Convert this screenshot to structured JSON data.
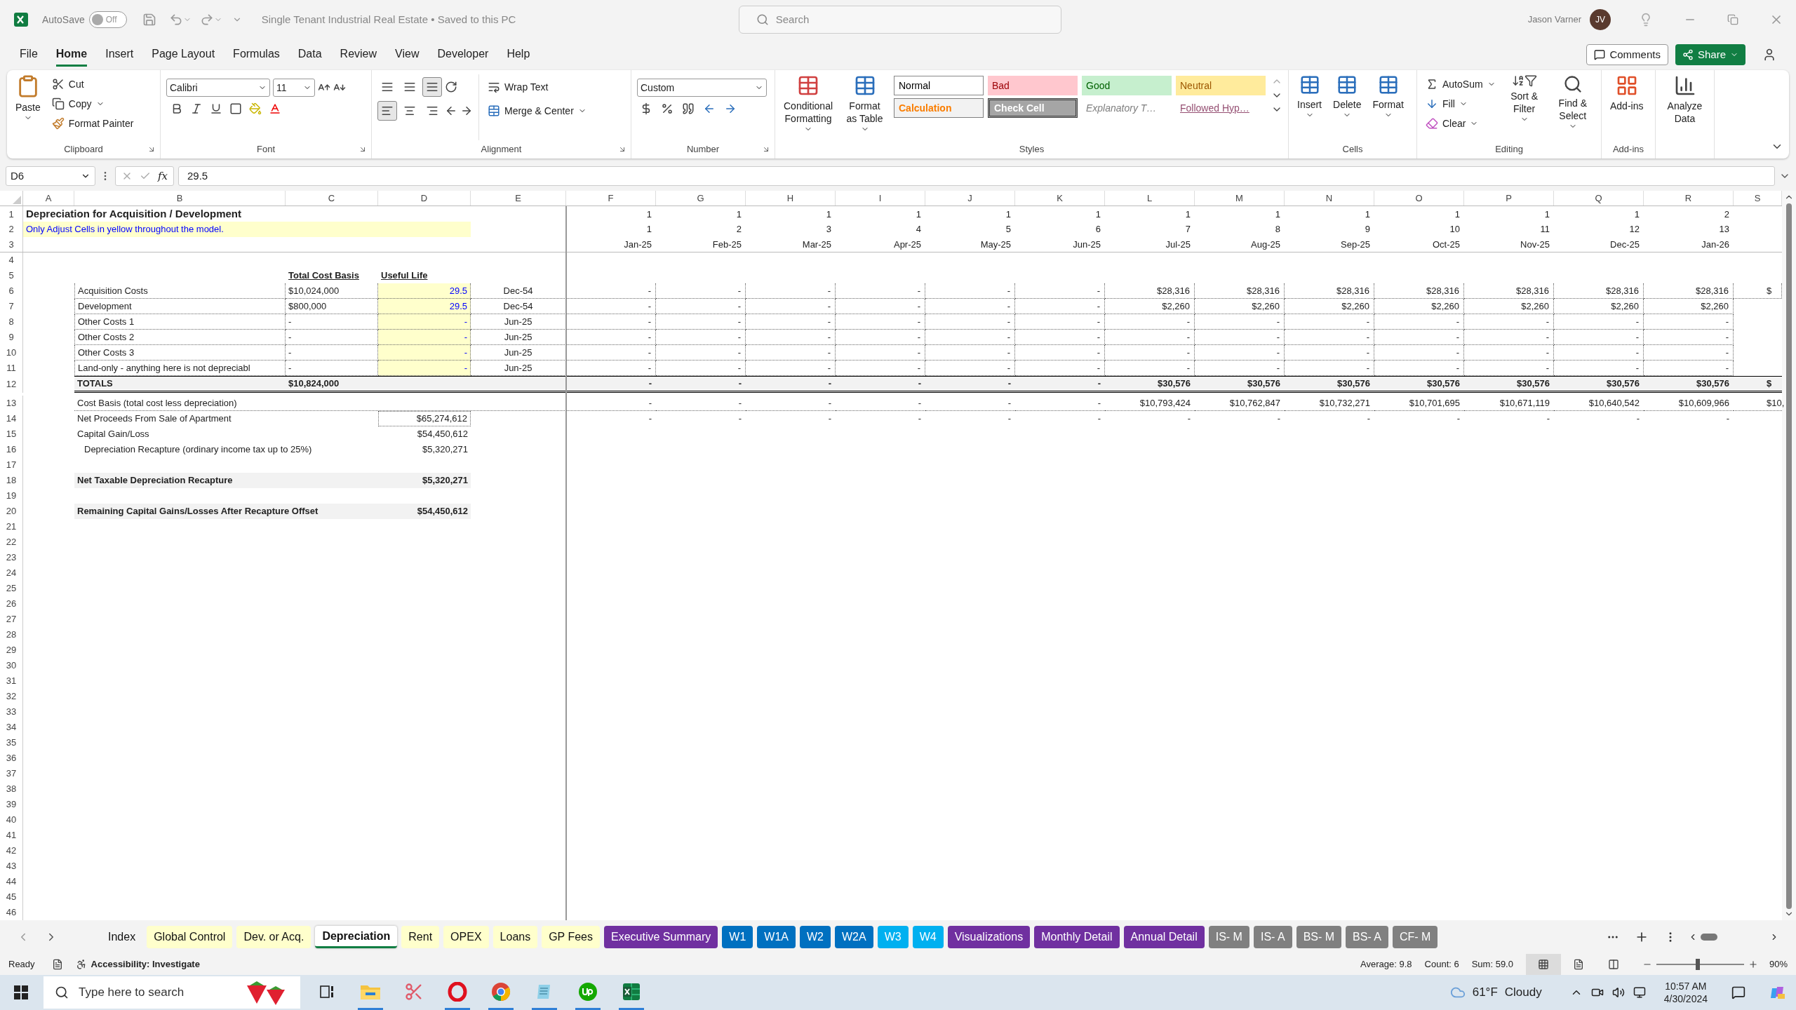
{
  "title_bar": {
    "autosave_label": "AutoSave",
    "autosave_state": "Off",
    "autosave_on": false,
    "doc_title": "Single Tenant Industrial Real Estate • Saved to this PC",
    "search_placeholder": "Search",
    "user_name": "Jason Varner",
    "user_initials": "JV"
  },
  "menu_tabs": [
    {
      "label": "File",
      "selected": false
    },
    {
      "label": "Home",
      "selected": true
    },
    {
      "label": "Insert",
      "selected": false
    },
    {
      "label": "Page Layout",
      "selected": false
    },
    {
      "label": "Formulas",
      "selected": false
    },
    {
      "label": "Data",
      "selected": false
    },
    {
      "label": "Review",
      "selected": false
    },
    {
      "label": "View",
      "selected": false
    },
    {
      "label": "Developer",
      "selected": false
    },
    {
      "label": "Help",
      "selected": false
    }
  ],
  "comments_button": "Comments",
  "share_button": "Share",
  "ribbon": {
    "clipboard": {
      "paste": "Paste",
      "cut": "Cut",
      "copy": "Copy",
      "format_painter": "Format Painter",
      "label": "Clipboard"
    },
    "font": {
      "name": "Calibri",
      "size": "11",
      "label": "Font"
    },
    "alignment": {
      "vertical_align": [
        {
          "selected": false
        },
        {
          "selected": false
        },
        {
          "selected": true
        }
      ],
      "horizontal_align": [
        {
          "selected": true
        },
        {
          "selected": false
        },
        {
          "selected": false
        }
      ],
      "wrap_text": "Wrap Text",
      "merge": "Merge & Center",
      "label": "Alignment"
    },
    "number": {
      "format": "Custom",
      "label": "Number"
    },
    "styles": {
      "conditional": "Conditional Formatting",
      "format_table": "Format as Table",
      "cells": [
        {
          "text": "Normal",
          "kind": "normal"
        },
        {
          "text": "Bad",
          "kind": "bad"
        },
        {
          "text": "Good",
          "kind": "good"
        },
        {
          "text": "Neutral",
          "kind": "neutral"
        },
        {
          "text": "Calculation",
          "kind": "calculation"
        },
        {
          "text": "Check Cell",
          "kind": "check"
        },
        {
          "text": "Explanatory T…",
          "kind": "explanatory"
        },
        {
          "text": "Followed Hyp…",
          "kind": "hyperlink"
        }
      ],
      "label": "Styles"
    },
    "cells": {
      "buttons": [
        "Insert",
        "Delete",
        "Format"
      ],
      "label": "Cells"
    },
    "editing": {
      "autosum": "AutoSum",
      "fill": "Fill",
      "clear": "Clear",
      "sort": "Sort & Filter",
      "find": "Find & Select",
      "label": "Editing"
    },
    "addins": {
      "button": "Add-ins",
      "label": "Add-ins"
    },
    "analyze": "Analyze Data"
  },
  "formula_bar": {
    "name_box": "D6",
    "function_label": "fx",
    "formula": "29.5"
  },
  "sheet": {
    "columns": [
      "A",
      "B",
      "C",
      "D",
      "E",
      "F",
      "G",
      "H",
      "I",
      "J",
      "K",
      "L",
      "M",
      "N",
      "O",
      "P",
      "Q",
      "R",
      "S"
    ],
    "rows": [
      {
        "n": "1",
        "kind": "title",
        "text": "Depreciation for Acquisition / Development",
        "months": [
          "1",
          "1",
          "1",
          "1",
          "1",
          "1",
          "1",
          "1",
          "1",
          "1",
          "1",
          "1",
          "2"
        ]
      },
      {
        "n": "2",
        "kind": "note",
        "text": "Only Adjust Cells in yellow throughout the model.",
        "months": [
          "1",
          "2",
          "3",
          "4",
          "5",
          "6",
          "7",
          "8",
          "9",
          "10",
          "11",
          "12",
          "13"
        ]
      },
      {
        "n": "3",
        "kind": "dates",
        "months": [
          "Jan-25",
          "Feb-25",
          "Mar-25",
          "Apr-25",
          "May-25",
          "Jun-25",
          "Jul-25",
          "Aug-25",
          "Sep-25",
          "Oct-25",
          "Nov-25",
          "Dec-25",
          "Jan-26"
        ]
      },
      {
        "n": "4",
        "kind": "blank"
      },
      {
        "n": "5",
        "kind": "headers",
        "cost_basis_heading": "Total Cost Basis",
        "useful_life_heading": "Useful Life"
      },
      {
        "n": "6",
        "kind": "item",
        "label": "Acquisition Costs",
        "cost_basis": "$10,024,000",
        "useful_life": "29.5",
        "end_date": "Dec-54",
        "months": [
          "-",
          "-",
          "-",
          "-",
          "-",
          "-",
          "$28,316",
          "$28,316",
          "$28,316",
          "$28,316",
          "$28,316",
          "$28,316",
          "$28,316"
        ],
        "cut_off": "$"
      },
      {
        "n": "7",
        "kind": "item",
        "label": "Development",
        "cost_basis": "$800,000",
        "useful_life": "29.5",
        "end_date": "Dec-54",
        "months": [
          "-",
          "-",
          "-",
          "-",
          "-",
          "-",
          "$2,260",
          "$2,260",
          "$2,260",
          "$2,260",
          "$2,260",
          "$2,260",
          "$2,260"
        ]
      },
      {
        "n": "8",
        "kind": "item",
        "label": "Other Costs 1",
        "cost_basis": "-",
        "useful_life": "-",
        "end_date": "Jun-25",
        "months": [
          "-",
          "-",
          "-",
          "-",
          "-",
          "-",
          "-",
          "-",
          "-",
          "-",
          "-",
          "-",
          "-"
        ]
      },
      {
        "n": "9",
        "kind": "item",
        "label": "Other Costs 2",
        "cost_basis": "-",
        "useful_life": "-",
        "end_date": "Jun-25",
        "months": [
          "-",
          "-",
          "-",
          "-",
          "-",
          "-",
          "-",
          "-",
          "-",
          "-",
          "-",
          "-",
          "-"
        ]
      },
      {
        "n": "10",
        "kind": "item",
        "label": "Other Costs 3",
        "cost_basis": "-",
        "useful_life": "-",
        "end_date": "Jun-25",
        "months": [
          "-",
          "-",
          "-",
          "-",
          "-",
          "-",
          "-",
          "-",
          "-",
          "-",
          "-",
          "-",
          "-"
        ]
      },
      {
        "n": "11",
        "kind": "item",
        "label": "Land-only - anything here is not depreciabl",
        "cost_basis": "-",
        "useful_life": "-",
        "end_date": "Jun-25",
        "months": [
          "-",
          "-",
          "-",
          "-",
          "-",
          "-",
          "-",
          "-",
          "-",
          "-",
          "-",
          "-",
          "-"
        ]
      },
      {
        "n": "12",
        "kind": "total",
        "label": "TOTALS",
        "cost_basis": "$10,824,000",
        "months": [
          "-",
          "-",
          "-",
          "-",
          "-",
          "-",
          "$30,576",
          "$30,576",
          "$30,576",
          "$30,576",
          "$30,576",
          "$30,576",
          "$30,576"
        ],
        "cut_off": "$"
      },
      {
        "n": "13",
        "kind": "line",
        "label": "Cost Basis (total cost less depreciation)",
        "months": [
          "-",
          "-",
          "-",
          "-",
          "-",
          "-",
          "$10,793,424",
          "$10,762,847",
          "$10,732,271",
          "$10,701,695",
          "$10,671,119",
          "$10,640,542",
          "$10,609,966"
        ],
        "cut_off": "$10,"
      },
      {
        "n": "14",
        "kind": "line",
        "label": "Net Proceeds From Sale of Apartment",
        "value": "$65,274,612",
        "boxed": true,
        "months": [
          "-",
          "-",
          "-",
          "-",
          "-",
          "-",
          "-",
          "-",
          "-",
          "-",
          "-",
          "-",
          "-"
        ]
      },
      {
        "n": "15",
        "kind": "line",
        "label": "Capital Gain/Loss",
        "value": "$54,450,612",
        "boxed": false
      },
      {
        "n": "16",
        "kind": "subline",
        "label": "Depreciation Recapture (ordinary income tax up to 25%)",
        "value": "$5,320,271"
      },
      {
        "n": "17",
        "kind": "blank"
      },
      {
        "n": "18",
        "kind": "summary",
        "label": "Net Taxable Depreciation Recapture",
        "value": "$5,320,271"
      },
      {
        "n": "19",
        "kind": "blank"
      },
      {
        "n": "20",
        "kind": "summary",
        "label": "Remaining Capital Gains/Losses After Recapture Offset",
        "value": "$54,450,612"
      },
      {
        "n": "21",
        "kind": "blank"
      },
      {
        "n": "22",
        "kind": "blank"
      },
      {
        "n": "23",
        "kind": "blank"
      },
      {
        "n": "24",
        "kind": "blank"
      },
      {
        "n": "25",
        "kind": "blank"
      },
      {
        "n": "26",
        "kind": "blank"
      },
      {
        "n": "27",
        "kind": "blank"
      },
      {
        "n": "28",
        "kind": "blank"
      },
      {
        "n": "29",
        "kind": "blank"
      },
      {
        "n": "30",
        "kind": "blank"
      },
      {
        "n": "31",
        "kind": "blank"
      },
      {
        "n": "32",
        "kind": "blank"
      },
      {
        "n": "33",
        "kind": "blank"
      },
      {
        "n": "34",
        "kind": "blank"
      },
      {
        "n": "35",
        "kind": "blank"
      },
      {
        "n": "36",
        "kind": "blank"
      },
      {
        "n": "37",
        "kind": "blank"
      },
      {
        "n": "38",
        "kind": "blank"
      },
      {
        "n": "39",
        "kind": "blank"
      },
      {
        "n": "40",
        "kind": "blank"
      },
      {
        "n": "41",
        "kind": "blank"
      },
      {
        "n": "42",
        "kind": "blank"
      },
      {
        "n": "43",
        "kind": "blank"
      },
      {
        "n": "44",
        "kind": "blank"
      },
      {
        "n": "45",
        "kind": "blank"
      },
      {
        "n": "46",
        "kind": "blank"
      }
    ]
  },
  "sheet_tabs": [
    {
      "label": "Index",
      "selected": false
    },
    {
      "label": "Global Control",
      "color": "#ffffcc",
      "selected": false
    },
    {
      "label": "Dev. or Acq.",
      "color": "#ffffcc",
      "selected": false
    },
    {
      "label": "Depreciation",
      "selected": true
    },
    {
      "label": "Rent",
      "color": "#ffffcc",
      "selected": false
    },
    {
      "label": "OPEX",
      "color": "#ffffcc",
      "selected": false
    },
    {
      "label": "Loans",
      "color": "#ffffcc",
      "selected": false
    },
    {
      "label": "GP Fees",
      "color": "#ffffcc",
      "selected": false
    },
    {
      "label": "Executive Summary",
      "color": "#7030a0",
      "selected": false
    },
    {
      "label": "W1",
      "color": "#0070c0",
      "selected": false
    },
    {
      "label": "W1A",
      "color": "#0070c0",
      "selected": false
    },
    {
      "label": "W2",
      "color": "#0070c0",
      "selected": false
    },
    {
      "label": "W2A",
      "color": "#0070c0",
      "selected": false
    },
    {
      "label": "W3",
      "color": "#00b0f0",
      "selected": false
    },
    {
      "label": "W4",
      "color": "#00b0f0",
      "selected": false
    },
    {
      "label": "Visualizations",
      "color": "#7030a0",
      "selected": false
    },
    {
      "label": "Monthly Detail",
      "color": "#7030a0",
      "selected": false
    },
    {
      "label": "Annual Detail",
      "color": "#7030a0",
      "selected": false
    },
    {
      "label": "IS- M",
      "color": "#808080",
      "selected": false
    },
    {
      "label": "IS- A",
      "color": "#808080",
      "selected": false
    },
    {
      "label": "BS- M",
      "color": "#808080",
      "selected": false
    },
    {
      "label": "BS- A",
      "color": "#808080",
      "selected": false
    },
    {
      "label": "CF- M",
      "color": "#808080",
      "selected": false
    }
  ],
  "status_bar": {
    "status": "Ready",
    "accessibility": "Accessibility: Investigate",
    "stats": [
      "Average: 9.8",
      "Count: 6",
      "Sum: 59.0"
    ],
    "views": [
      {
        "kind": "normal",
        "selected": true
      },
      {
        "kind": "page_layout",
        "selected": false
      },
      {
        "kind": "page_break",
        "selected": false
      }
    ],
    "zoom": {
      "level": 0.45,
      "reading": "90%"
    }
  },
  "taskbar": {
    "search_placeholder": "Type here to search",
    "apps": [
      {
        "kind": "task_view",
        "running": false
      },
      {
        "kind": "explorer",
        "running": true
      },
      {
        "kind": "snipping",
        "running": false
      },
      {
        "kind": "opera",
        "running": true
      },
      {
        "kind": "chrome",
        "running": true
      },
      {
        "kind": "notepad",
        "running": true
      },
      {
        "kind": "upwork",
        "running": true
      },
      {
        "kind": "excel",
        "running": true
      }
    ],
    "temperature": "61°F",
    "condition": "Cloudy",
    "time": "10:57 AM",
    "date": "4/30/2024"
  }
}
